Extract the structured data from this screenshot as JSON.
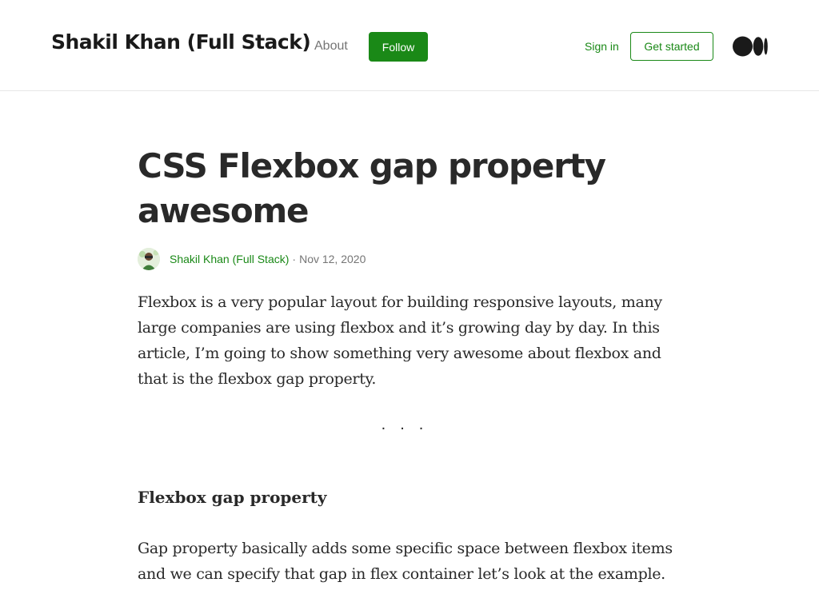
{
  "header": {
    "publication_title": "Shakil Khan (Full Stack)",
    "about_label": "About",
    "follow_label": "Follow",
    "signin_label": "Sign in",
    "get_started_label": "Get started",
    "logo_icon": "medium-logo-icon"
  },
  "article": {
    "title": "CSS Flexbox gap property awesome",
    "author": "Shakil Khan (Full Stack)",
    "byline_separator": "·",
    "date": "Nov 12, 2020",
    "paragraph_1": "Flexbox is a very popular layout for building responsive layouts, many large companies are using flexbox and it’s growing day by day. In this article, I’m going to show something very awesome about flexbox and that is the flexbox gap property.",
    "section_separator": "...",
    "section_heading": "Flexbox gap property",
    "paragraph_2": "Gap property basically adds some specific space between flexbox items and we can specify that gap in flex container let’s look at the example."
  },
  "colors": {
    "accent_green": "#1a8917",
    "text_primary": "#292929",
    "text_muted": "#757575"
  }
}
